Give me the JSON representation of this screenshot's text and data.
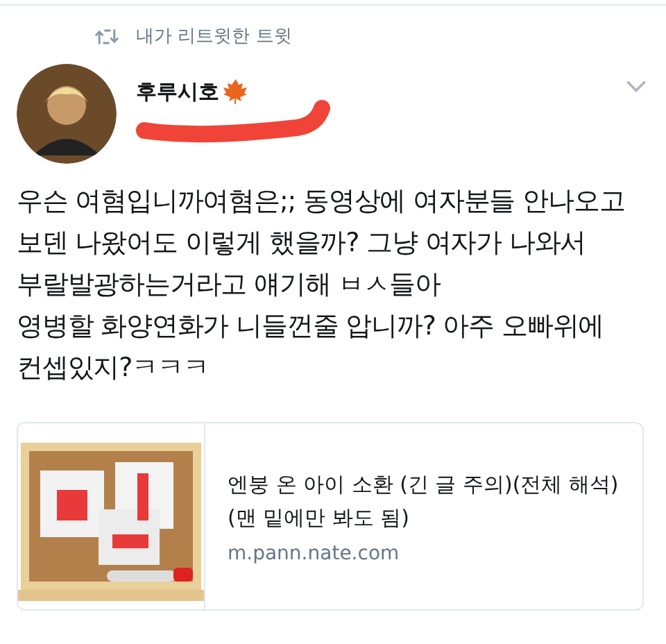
{
  "retweet_header": {
    "label": "내가 리트윗한 트윗"
  },
  "author": {
    "name": "후루시호"
  },
  "tweet_lines": [
    "우슨 여혐입니까여혐은;;  동영상에 여자분들 안나오고",
    "보덴 나왔어도 이렇게 했을까?  그냥 여자가 나와서",
    "부랄발광하는거라고 얘기해 ㅂㅅ들아",
    "영병할 화양연화가 니들껀줄 압니까? 아주 오빠위에",
    "컨셉있지?ㅋㅋㅋ"
  ],
  "link_card": {
    "title": "엔붕 온 아이 소환 (긴 글 주의)(전체 해석)(맨 밑에만 봐도 됨)",
    "domain": "m.pann.nate.com"
  }
}
